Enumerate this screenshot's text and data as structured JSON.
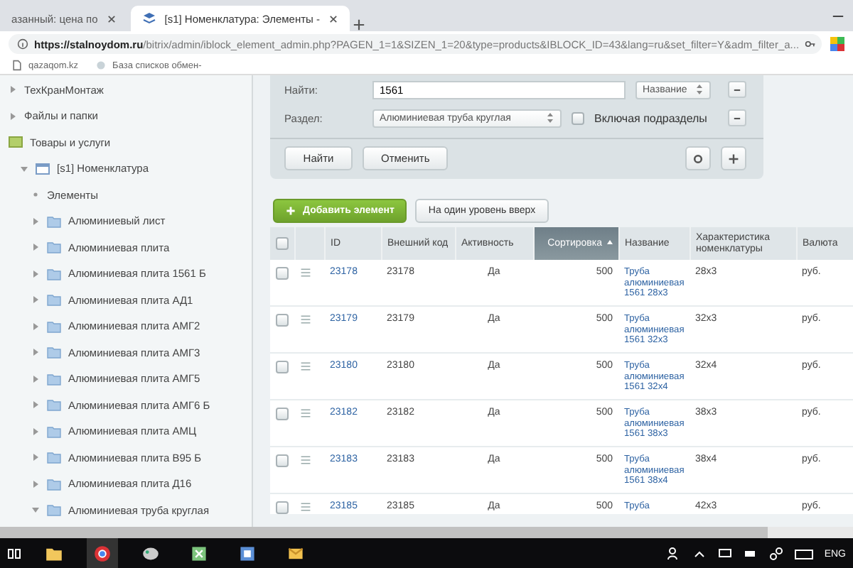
{
  "browser": {
    "tabs": [
      {
        "title": "азанный: цена по",
        "selected": false
      },
      {
        "title": "[s1] Номенклатура: Элементы -",
        "selected": true
      }
    ],
    "url_host": "https://stalnoydom.ru",
    "url_path": "/bitrix/admin/iblock_element_admin.php?PAGEN_1=1&SIZEN_1=20&type=products&IBLOCK_ID=43&lang=ru&set_filter=Y&adm_filter_a...",
    "bookmarks": [
      "qazaqom.kz",
      "База списков обмен-"
    ]
  },
  "sidebar": {
    "items": [
      {
        "label": "ТехКранМонтаж",
        "kind": "section",
        "expanded": false
      },
      {
        "label": "Файлы и папки",
        "kind": "section",
        "expanded": false
      },
      {
        "label": "Товары и услуги",
        "kind": "root",
        "children": [
          {
            "label": "[s1] Номенклатура",
            "kind": "catalog",
            "expanded": true,
            "children": [
              {
                "label": "Элементы",
                "kind": "link"
              },
              {
                "label": "Алюминиевый лист",
                "kind": "folder",
                "expanded": false
              },
              {
                "label": "Алюминиевая плита",
                "kind": "folder",
                "expanded": false
              },
              {
                "label": "Алюминиевая плита 1561 Б",
                "kind": "folder",
                "expanded": false
              },
              {
                "label": "Алюминиевая плита АД1",
                "kind": "folder",
                "expanded": false
              },
              {
                "label": "Алюминиевая плита АМГ2",
                "kind": "folder",
                "expanded": false
              },
              {
                "label": "Алюминиевая плита АМГ3",
                "kind": "folder",
                "expanded": false
              },
              {
                "label": "Алюминиевая плита АМГ5",
                "kind": "folder",
                "expanded": false
              },
              {
                "label": "Алюминиевая плита АМГ6 Б",
                "kind": "folder",
                "expanded": false
              },
              {
                "label": "Алюминиевая плита АМЦ",
                "kind": "folder",
                "expanded": false
              },
              {
                "label": "Алюминиевая плита В95 Б",
                "kind": "folder",
                "expanded": false
              },
              {
                "label": "Алюминиевая плита Д16",
                "kind": "folder",
                "expanded": false
              },
              {
                "label": "Алюминиевая труба круглая",
                "kind": "folder",
                "expanded": true
              }
            ]
          }
        ]
      }
    ]
  },
  "filter": {
    "find_label": "Найти:",
    "find_value": "1561",
    "find_field": "Название",
    "section_label": "Раздел:",
    "section_value": "Алюминиевая труба круглая",
    "include_subsections": {
      "label": "Включая подразделы",
      "checked": false
    },
    "buttons": [
      "Найти",
      "Отменить"
    ]
  },
  "toolbar": {
    "add_button": "Добавить элемент",
    "up_button": "На один уровень вверх"
  },
  "table": {
    "header_checked": false,
    "columns": [
      {
        "label": "ID",
        "sorted": false
      },
      {
        "label": "Внешний код",
        "sorted": false
      },
      {
        "label": "Активность",
        "sorted": false
      },
      {
        "label": "Сортировка",
        "sorted": true
      },
      {
        "label": "Название",
        "sorted": false
      },
      {
        "label": "Характеристика номенклатуры",
        "sorted": false
      },
      {
        "label": "Валюта",
        "sorted": false
      }
    ],
    "rows": [
      {
        "checked": false,
        "id": "23178",
        "code": "23178",
        "active": "Да",
        "sort": "500",
        "name": "Труба алюминиевая 1561 28x3",
        "spec": "28x3",
        "currency": "руб."
      },
      {
        "checked": false,
        "id": "23179",
        "code": "23179",
        "active": "Да",
        "sort": "500",
        "name": "Труба алюминиевая 1561 32x3",
        "spec": "32x3",
        "currency": "руб."
      },
      {
        "checked": false,
        "id": "23180",
        "code": "23180",
        "active": "Да",
        "sort": "500",
        "name": "Труба алюминиевая 1561 32x4",
        "spec": "32x4",
        "currency": "руб."
      },
      {
        "checked": false,
        "id": "23182",
        "code": "23182",
        "active": "Да",
        "sort": "500",
        "name": "Труба алюминиевая 1561 38x3",
        "spec": "38x3",
        "currency": "руб."
      },
      {
        "checked": false,
        "id": "23183",
        "code": "23183",
        "active": "Да",
        "sort": "500",
        "name": "Труба алюминиевая 1561 38x4",
        "spec": "38x4",
        "currency": "руб."
      },
      {
        "checked": false,
        "id": "23185",
        "code": "23185",
        "active": "Да",
        "sort": "500",
        "name": "Труба",
        "spec": "42x3",
        "currency": "руб."
      }
    ]
  },
  "taskbar": {
    "language": "ENG"
  }
}
